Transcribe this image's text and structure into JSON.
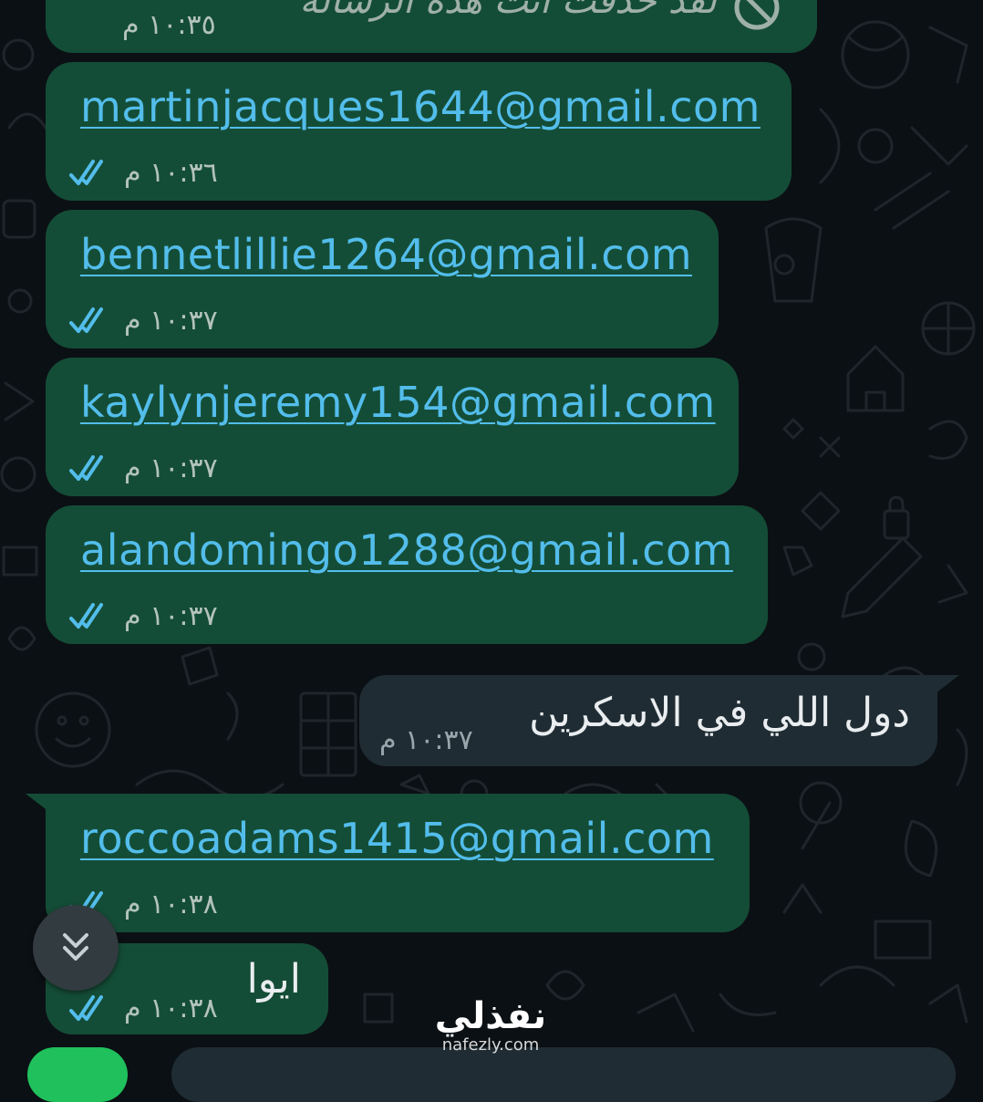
{
  "chat": {
    "deleted_message": {
      "text": "لقد حذفت أنت هذه الرسالة",
      "time": "١٠:٣٥ م"
    },
    "messages": [
      {
        "type": "outgoing",
        "text": "martinjacques1644@gmail.com",
        "time": "١٠:٣٦ م",
        "status": "read"
      },
      {
        "type": "outgoing",
        "text": "bennetlillie1264@gmail.com",
        "time": "١٠:٣٧ م",
        "status": "read"
      },
      {
        "type": "outgoing",
        "text": "kaylynjeremy154@gmail.com",
        "time": "١٠:٣٧ م",
        "status": "read"
      },
      {
        "type": "outgoing",
        "text": "alandomingo1288@gmail.com",
        "time": "١٠:٣٧ م",
        "status": "read"
      },
      {
        "type": "incoming",
        "text": "دول اللي في الاسكرين",
        "time": "١٠:٣٧ م"
      },
      {
        "type": "outgoing",
        "text": "roccoadams1415@gmail.com",
        "time": "١٠:٣٨ م",
        "status": "read"
      },
      {
        "type": "outgoing",
        "text": "ايوا",
        "time": "١٠:٣٨ م",
        "status": "read"
      }
    ]
  },
  "watermark": {
    "brand": "نفذلي",
    "url": "nafezly.com"
  },
  "icons": {
    "deleted": "block-icon",
    "read_receipt": "double-check-icon",
    "scroll": "double-chevron-down-icon"
  },
  "colors": {
    "background": "#0b1014",
    "outgoing_bubble": "#144d37",
    "incoming_bubble": "#1f2c33",
    "link": "#53bdeb",
    "read_tick": "#53bdeb",
    "accent_green": "#20c05c"
  }
}
